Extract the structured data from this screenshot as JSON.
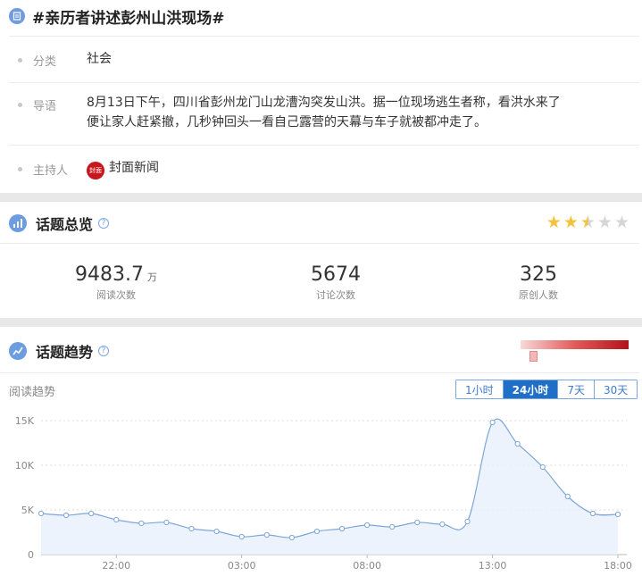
{
  "header": {
    "title": "#亲历者讲述彭州山洪现场#",
    "icon": "document-icon"
  },
  "info": {
    "category_label": "分类",
    "category_value": "社会",
    "intro_label": "导语",
    "intro_line1": "8月13日下午，四川省彭州龙门山龙漕沟突发山洪。据一位现场逃生者称，看洪水来了",
    "intro_line2": "便让家人赶紧撤，几秒钟回头一看自己露营的天幕与车子就被都冲走了。",
    "host_label": "主持人",
    "host_name": "封面新闻",
    "host_logo_text": "封面"
  },
  "overview": {
    "title": "话题总览",
    "rating": 2.5,
    "stats": [
      {
        "value": "9483.7",
        "unit": "万",
        "caption": "阅读次数"
      },
      {
        "value": "5674",
        "unit": "",
        "caption": "讨论次数"
      },
      {
        "value": "325",
        "unit": "",
        "caption": "原创人数"
      }
    ]
  },
  "trend": {
    "title": "话题趋势",
    "subtitle": "阅读趋势",
    "tabs": [
      {
        "label": "1小时",
        "active": false
      },
      {
        "label": "24小时",
        "active": true
      },
      {
        "label": "7天",
        "active": false
      },
      {
        "label": "30天",
        "active": false
      }
    ],
    "colors": {
      "line": "#7ea6d8",
      "fill": "#e8f0fb",
      "accent": "#1f6fc7"
    }
  },
  "chart_data": {
    "type": "line",
    "title": "",
    "xlabel": "",
    "ylabel": "",
    "ylim": [
      0,
      15000
    ],
    "y_ticks": [
      "0",
      "5K",
      "10K",
      "15K"
    ],
    "x_ticks": [
      "22:00",
      "03:00",
      "08:00",
      "13:00",
      "18:00"
    ],
    "series": [
      {
        "values": [
          4600,
          4400,
          4600,
          3900,
          3500,
          3600,
          2900,
          2600,
          2000,
          2200,
          1900,
          2600,
          2900,
          3300,
          3100,
          3600,
          3400,
          3700,
          14800,
          12400,
          9800,
          6500,
          4600,
          4500
        ]
      }
    ]
  }
}
